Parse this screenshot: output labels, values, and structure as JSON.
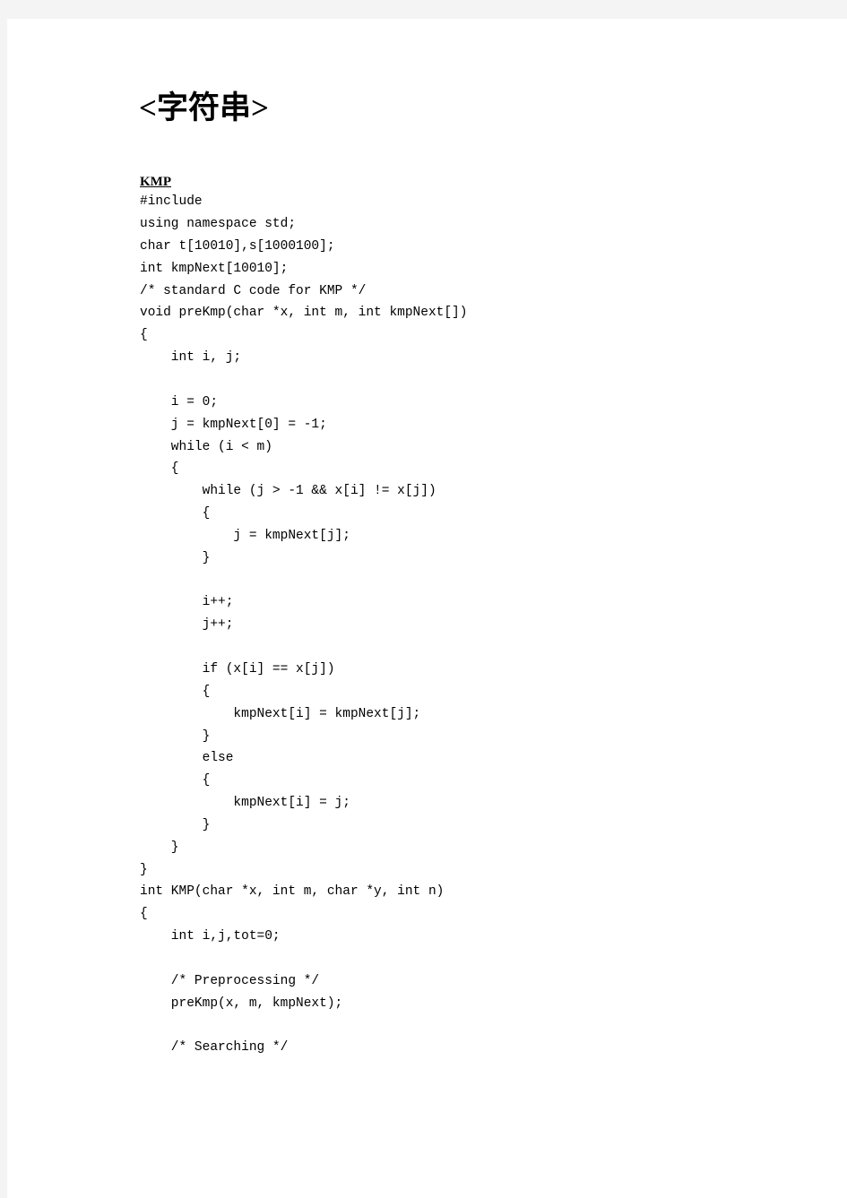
{
  "document": {
    "title": "<字符串>",
    "section": {
      "heading": "KMP",
      "code_lines": [
        "#include",
        "using namespace std;",
        "char t[10010],s[1000100];",
        "int kmpNext[10010];",
        "/* standard C code for KMP */",
        "void preKmp(char *x, int m, int kmpNext[])",
        "{",
        "    int i, j;",
        "",
        "    i = 0;",
        "    j = kmpNext[0] = -1;",
        "    while (i < m)",
        "    {",
        "        while (j > -1 && x[i] != x[j])",
        "        {",
        "            j = kmpNext[j];",
        "        }",
        "",
        "        i++;",
        "        j++;",
        "",
        "        if (x[i] == x[j])",
        "        {",
        "            kmpNext[i] = kmpNext[j];",
        "        }",
        "        else",
        "        {",
        "            kmpNext[i] = j;",
        "        }",
        "    }",
        "}",
        "int KMP(char *x, int m, char *y, int n)",
        "{",
        "    int i,j,tot=0;",
        "",
        "    /* Preprocessing */",
        "    preKmp(x, m, kmpNext);",
        "",
        "    /* Searching */"
      ]
    }
  },
  "colors": {
    "page_background": "#ffffff",
    "canvas_background": "#f4f4f4",
    "text": "#000000"
  }
}
